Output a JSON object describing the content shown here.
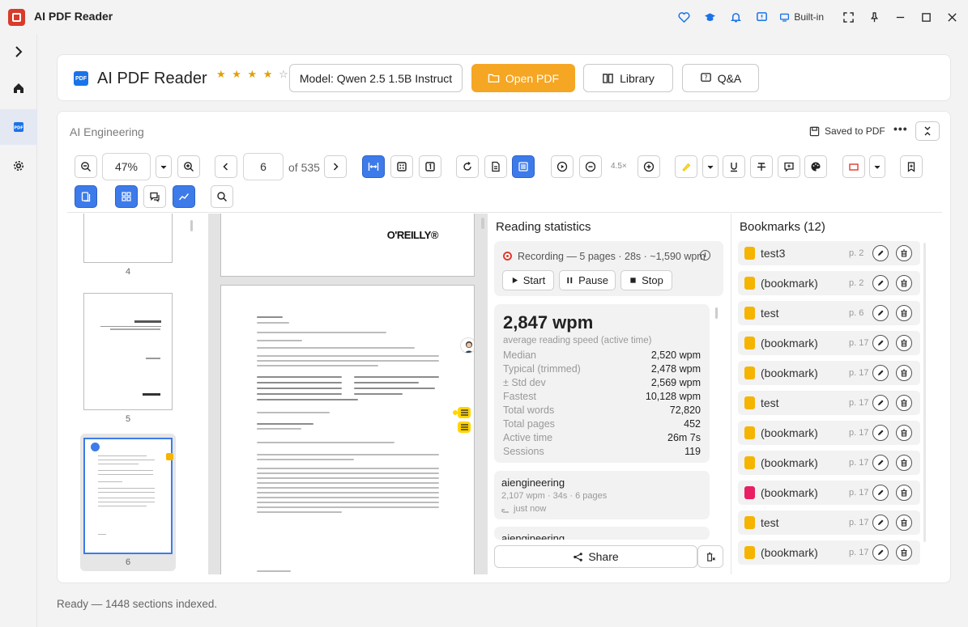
{
  "app": {
    "title": "AI PDF Reader",
    "mode_label": "Built-in"
  },
  "header": {
    "title": "AI PDF Reader",
    "logo_text": "PDF",
    "stars_filled": "★ ★ ★ ★",
    "stars_empty": "☆",
    "rating": 4,
    "model_label": "Model: Qwen 2.5 1.5B Instruct",
    "open_pdf_label": "Open PDF",
    "library_label": "Library",
    "qa_label": "Q&A"
  },
  "document": {
    "title": "AI Engineering",
    "saved_label": "Saved to PDF",
    "more": "•••"
  },
  "toolbar": {
    "zoom": "47%",
    "page": "6",
    "of_pages": "of 535",
    "speed": "4.5×"
  },
  "thumbnails": [
    {
      "page": "4"
    },
    {
      "page": "5"
    },
    {
      "page": "6"
    }
  ],
  "viewer": {
    "publisher_logo": "O'REILLY®"
  },
  "stats": {
    "title": "Reading statistics",
    "recording_text": "Recording — 5 pages · 28s · ~1,590 wpm",
    "start_label": "Start",
    "pause_label": "Pause",
    "stop_label": "Stop",
    "wpm": "2,847 wpm",
    "wpm_caption": "average reading speed (active time)",
    "rows": [
      {
        "k": "Median",
        "v": "2,520 wpm"
      },
      {
        "k": "Typical (trimmed)",
        "v": "2,478 wpm"
      },
      {
        "k": "± Std dev",
        "v": "2,569 wpm"
      },
      {
        "k": "Fastest",
        "v": "10,128 wpm"
      },
      {
        "k": "Total words",
        "v": "72,820"
      },
      {
        "k": "Total pages",
        "v": "452"
      },
      {
        "k": "Active time",
        "v": "26m 7s"
      },
      {
        "k": "Sessions",
        "v": "119"
      }
    ],
    "sessions": [
      {
        "name": "aiengineering",
        "meta": "2,107 wpm · 34s · 6 pages",
        "when": "just now"
      },
      {
        "name": "aiengineering",
        "meta": "",
        "when": ""
      }
    ],
    "share_label": "Share"
  },
  "bookmarks": {
    "title": "Bookmarks (12)",
    "items": [
      {
        "label": "test3",
        "page": "p. 2",
        "color": "#f5b400"
      },
      {
        "label": "(bookmark)",
        "page": "p. 2",
        "color": "#f5b400"
      },
      {
        "label": "test",
        "page": "p. 6",
        "color": "#f5b400"
      },
      {
        "label": "(bookmark)",
        "page": "p. 17",
        "color": "#f5b400"
      },
      {
        "label": "(bookmark)",
        "page": "p. 17",
        "color": "#f5b400"
      },
      {
        "label": "test",
        "page": "p. 17",
        "color": "#f5b400"
      },
      {
        "label": "(bookmark)",
        "page": "p. 17",
        "color": "#f5b400"
      },
      {
        "label": "(bookmark)",
        "page": "p. 17",
        "color": "#f5b400"
      },
      {
        "label": "(bookmark)",
        "page": "p. 17",
        "color": "#e91e63"
      },
      {
        "label": "test",
        "page": "p. 17",
        "color": "#f5b400"
      },
      {
        "label": "(bookmark)",
        "page": "p. 17",
        "color": "#f5b400"
      }
    ]
  },
  "status": {
    "text": "Ready — 1448 sections indexed."
  },
  "colors": {
    "accent": "#3d7bea",
    "orange": "#f5a623",
    "brand_red": "#d93b2b"
  }
}
